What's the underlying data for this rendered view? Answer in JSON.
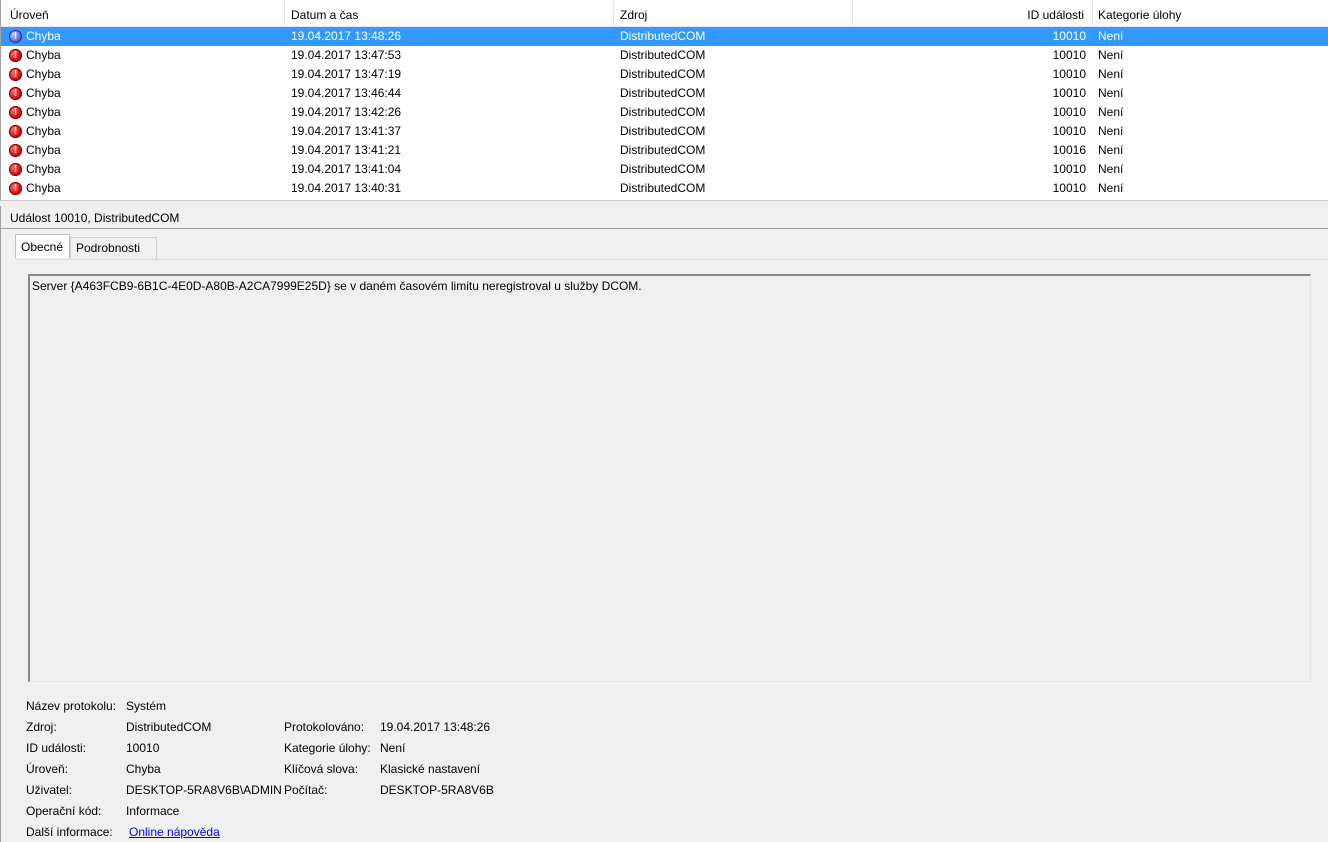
{
  "columns": {
    "level": "Úroveň",
    "datetime": "Datum a čas",
    "source": "Zdroj",
    "event_id": "ID události",
    "category": "Kategorie úlohy"
  },
  "events": [
    {
      "level": "Chyba",
      "datetime": "19.04.2017 13:48:26",
      "source": "DistributedCOM",
      "event_id": "10010",
      "category": "Není",
      "selected": true
    },
    {
      "level": "Chyba",
      "datetime": "19.04.2017 13:47:53",
      "source": "DistributedCOM",
      "event_id": "10010",
      "category": "Není"
    },
    {
      "level": "Chyba",
      "datetime": "19.04.2017 13:47:19",
      "source": "DistributedCOM",
      "event_id": "10010",
      "category": "Není"
    },
    {
      "level": "Chyba",
      "datetime": "19.04.2017 13:46:44",
      "source": "DistributedCOM",
      "event_id": "10010",
      "category": "Není"
    },
    {
      "level": "Chyba",
      "datetime": "19.04.2017 13:42:26",
      "source": "DistributedCOM",
      "event_id": "10010",
      "category": "Není"
    },
    {
      "level": "Chyba",
      "datetime": "19.04.2017 13:41:37",
      "source": "DistributedCOM",
      "event_id": "10010",
      "category": "Není"
    },
    {
      "level": "Chyba",
      "datetime": "19.04.2017 13:41:21",
      "source": "DistributedCOM",
      "event_id": "10016",
      "category": "Není"
    },
    {
      "level": "Chyba",
      "datetime": "19.04.2017 13:41:04",
      "source": "DistributedCOM",
      "event_id": "10010",
      "category": "Není"
    },
    {
      "level": "Chyba",
      "datetime": "19.04.2017 13:40:31",
      "source": "DistributedCOM",
      "event_id": "10010",
      "category": "Není"
    }
  ],
  "icons": {
    "event_level": "error-icon"
  },
  "colors": {
    "selection": "#3399ff",
    "error": "#d21414",
    "link": "#0000ee"
  },
  "detail": {
    "title": "Událost 10010, DistributedCOM",
    "tabs": {
      "general": "Obecné",
      "details": "Podrobnosti"
    },
    "message": "Server {A463FCB9-6B1C-4E0D-A80B-A2CA7999E25D} se v daném časovém limitu neregistroval u služby DCOM.",
    "props": {
      "log_name_label": "Název protokolu:",
      "log_name": "Systém",
      "source_label": "Zdroj:",
      "source": "DistributedCOM",
      "logged_label": "Protokolováno:",
      "logged": "19.04.2017 13:48:26",
      "event_id_label": "ID události:",
      "event_id": "10010",
      "task_category_label": "Kategorie úlohy:",
      "task_category": "Není",
      "level_label": "Úroveň:",
      "level": "Chyba",
      "keywords_label": "Klíčová slova:",
      "keywords": "Klasické nastavení",
      "user_label": "Uživatel:",
      "user": "DESKTOP-5RA8V6B\\ADMIN",
      "computer_label": "Počítač:",
      "computer": "DESKTOP-5RA8V6B",
      "opcode_label": "Operační kód:",
      "opcode": "Informace",
      "more_info_label": "Další informace:",
      "more_info_link": "Online nápověda"
    }
  }
}
